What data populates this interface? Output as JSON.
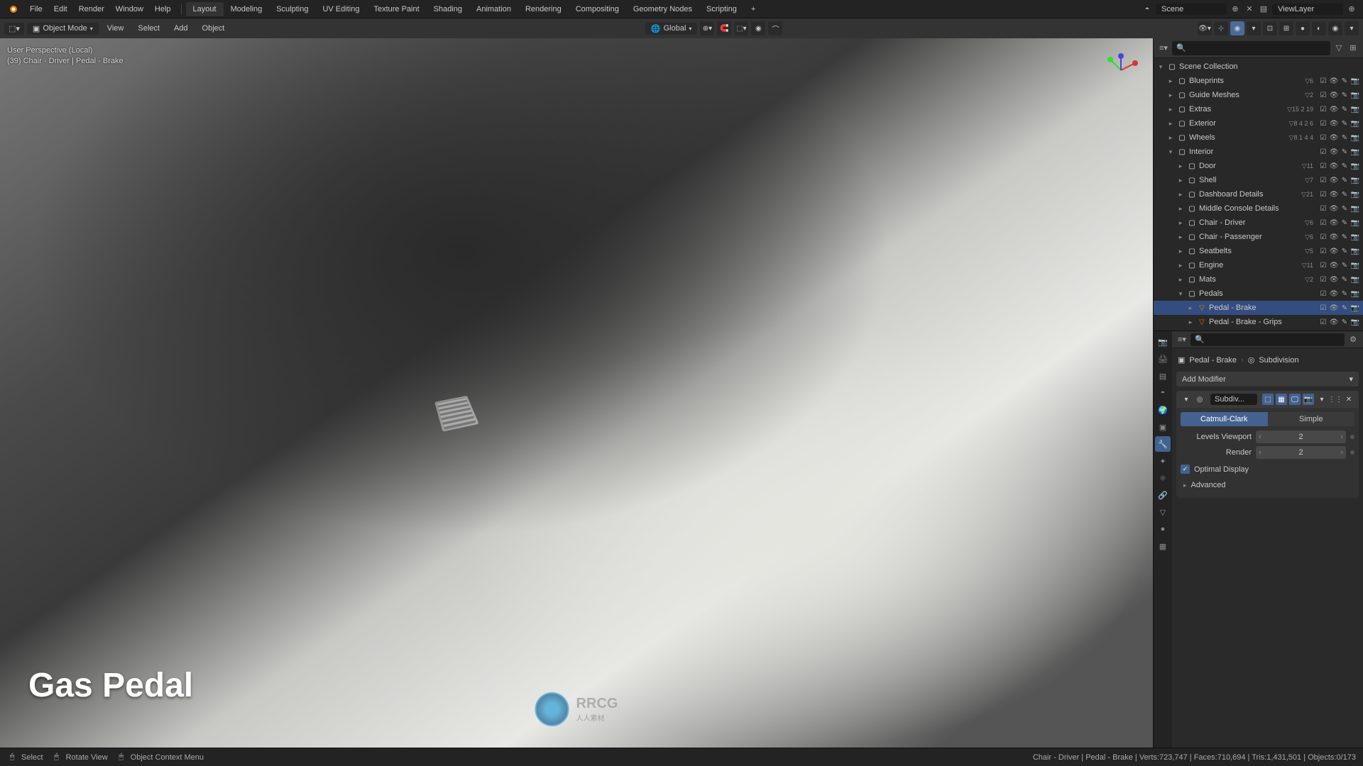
{
  "top_menu": {
    "file": "File",
    "edit": "Edit",
    "render": "Render",
    "window": "Window",
    "help": "Help"
  },
  "workspace_tabs": [
    "Layout",
    "Modeling",
    "Sculpting",
    "UV Editing",
    "Texture Paint",
    "Shading",
    "Animation",
    "Rendering",
    "Compositing",
    "Geometry Nodes",
    "Scripting"
  ],
  "workspace_active": "Layout",
  "header_right": {
    "scene_label": "Scene",
    "viewlayer_label": "ViewLayer"
  },
  "toolbar": {
    "mode": "Object Mode",
    "view": "View",
    "select": "Select",
    "add": "Add",
    "object": "Object",
    "orientation": "Global"
  },
  "viewport": {
    "overlay_line1": "User Perspective (Local)",
    "overlay_line2": "(39) Chair - Driver | Pedal - Brake",
    "label": "Gas Pedal",
    "watermark_main": "RRCG",
    "watermark_sub": "人人素材"
  },
  "outliner": {
    "root": "Scene Collection",
    "items": [
      {
        "label": "Blueprints",
        "count": "6",
        "indent": 1,
        "expanded": false,
        "icon": "▸"
      },
      {
        "label": "Guide Meshes",
        "count": "2",
        "indent": 1,
        "expanded": false,
        "icon": "▸"
      },
      {
        "label": "Extras",
        "count": "15 2 19",
        "indent": 1,
        "expanded": false,
        "icon": "▸"
      },
      {
        "label": "Exterior",
        "count": "8 4 2 6",
        "indent": 1,
        "expanded": false,
        "icon": "▸"
      },
      {
        "label": "Wheels",
        "count": "8 1 4 4",
        "indent": 1,
        "expanded": false,
        "icon": "▸"
      },
      {
        "label": "Interior",
        "count": "",
        "indent": 1,
        "expanded": true,
        "icon": "▾"
      },
      {
        "label": "Door",
        "count": "11",
        "indent": 2,
        "expanded": false,
        "icon": "▸"
      },
      {
        "label": "Shell",
        "count": "7",
        "indent": 2,
        "expanded": false,
        "icon": "▸"
      },
      {
        "label": "Dashboard Details",
        "count": "21",
        "indent": 2,
        "expanded": false,
        "icon": "▸"
      },
      {
        "label": "Middle Console Details",
        "count": "",
        "indent": 2,
        "expanded": false,
        "icon": "▸"
      },
      {
        "label": "Chair - Driver",
        "count": "6",
        "indent": 2,
        "expanded": false,
        "icon": "▸"
      },
      {
        "label": "Chair - Passenger",
        "count": "6",
        "indent": 2,
        "expanded": false,
        "icon": "▸"
      },
      {
        "label": "Seatbelts",
        "count": "5",
        "indent": 2,
        "expanded": false,
        "icon": "▸"
      },
      {
        "label": "Engine",
        "count": "11",
        "indent": 2,
        "expanded": false,
        "icon": "▸"
      },
      {
        "label": "Mats",
        "count": "2",
        "indent": 2,
        "expanded": false,
        "icon": "▸"
      },
      {
        "label": "Pedals",
        "count": "",
        "indent": 2,
        "expanded": true,
        "icon": "▾"
      },
      {
        "label": "Pedal - Brake",
        "count": "",
        "indent": 3,
        "expanded": false,
        "icon": "▸",
        "mesh": true,
        "active": true
      },
      {
        "label": "Pedal - Brake - Grips",
        "count": "",
        "indent": 3,
        "expanded": false,
        "icon": "▸",
        "mesh": true
      }
    ]
  },
  "properties": {
    "breadcrumb_obj": "Pedal - Brake",
    "breadcrumb_mod": "Subdivision",
    "add_modifier": "Add Modifier",
    "modifier_name": "Subdiv...",
    "subdiv_type_a": "Catmull-Clark",
    "subdiv_type_b": "Simple",
    "levels_viewport_label": "Levels Viewport",
    "levels_viewport_value": "2",
    "render_label": "Render",
    "render_value": "2",
    "optimal_display": "Optimal Display",
    "advanced": "Advanced"
  },
  "status_bar": {
    "select": "Select",
    "rotate": "Rotate View",
    "context_menu": "Object Context Menu",
    "info": "Chair - Driver | Pedal - Brake | Verts:723,747 | Faces:710,694 | Tris:1,431,501 | Objects:0/173"
  }
}
